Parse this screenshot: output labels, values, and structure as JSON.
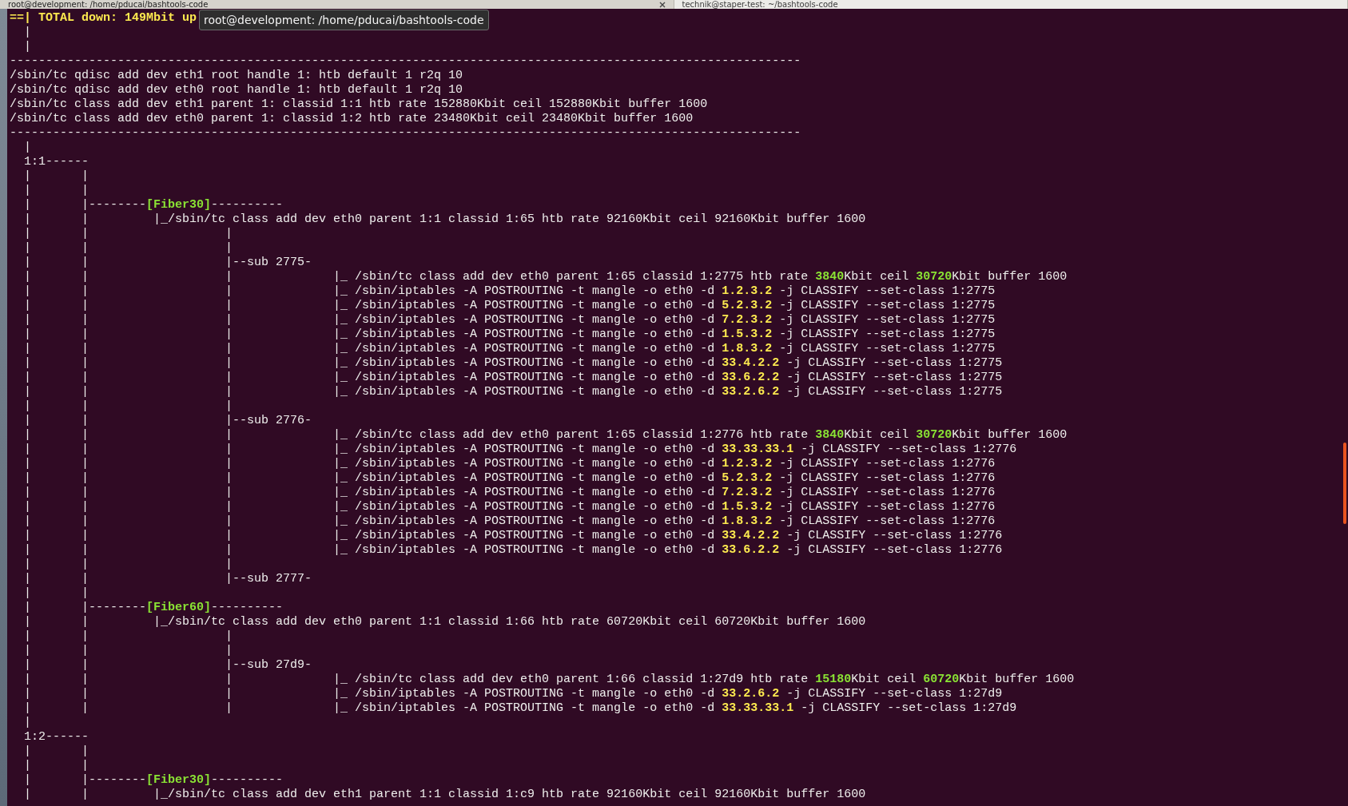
{
  "tabs": [
    {
      "label": "root@development: /home/pducai/bashtools-code",
      "selected": true
    },
    {
      "label": "technik@staper-test: ~/bashtools-code",
      "selected": false
    }
  ],
  "tooltip": "root@development: /home/pducai/bashtools-code",
  "lines": [
    [
      {
        "text": "==| TOTAL down: 149Mbit up",
        "kind": "header"
      }
    ],
    [
      {
        "text": "  |",
        "kind": "plain"
      }
    ],
    [
      {
        "text": "  |",
        "kind": "plain"
      }
    ],
    [
      {
        "text": "--------------------------------------------------------------------------------------------------------------",
        "kind": "plain"
      }
    ],
    [
      {
        "text": "/sbin/tc qdisc add dev eth1 root handle 1: htb default 1 r2q 10",
        "kind": "plain"
      }
    ],
    [
      {
        "text": "/sbin/tc qdisc add dev eth0 root handle 1: htb default 1 r2q 10",
        "kind": "plain"
      }
    ],
    [
      {
        "text": "/sbin/tc class add dev eth1 parent 1: classid 1:1 htb rate 152880Kbit ceil 152880Kbit buffer 1600",
        "kind": "plain"
      }
    ],
    [
      {
        "text": "/sbin/tc class add dev eth0 parent 1: classid 1:2 htb rate 23480Kbit ceil 23480Kbit buffer 1600",
        "kind": "plain"
      }
    ],
    [
      {
        "text": "--------------------------------------------------------------------------------------------------------------",
        "kind": "plain"
      }
    ],
    [
      {
        "text": "  |",
        "kind": "plain"
      }
    ],
    [
      {
        "text": "  1:1------",
        "kind": "plain"
      }
    ],
    [
      {
        "text": "  |       |",
        "kind": "plain"
      }
    ],
    [
      {
        "text": "  |       |",
        "kind": "plain"
      }
    ],
    [
      {
        "text": "  |       |--------",
        "kind": "plain"
      },
      {
        "text": "[Fiber30]",
        "kind": "group"
      },
      {
        "text": "----------",
        "kind": "plain"
      }
    ],
    [
      {
        "text": "  |       |         |_/sbin/tc class add dev eth0 parent 1:1 classid 1:65 htb rate 92160Kbit ceil 92160Kbit buffer 1600",
        "kind": "plain"
      }
    ],
    [
      {
        "text": "  |       |                   |",
        "kind": "plain"
      }
    ],
    [
      {
        "text": "  |       |                   |",
        "kind": "plain"
      }
    ],
    [
      {
        "text": "  |       |                   |--sub 2775-",
        "kind": "plain"
      }
    ],
    [
      {
        "text": "  |       |                   |              |_ /sbin/tc class add dev eth0 parent 1:65 classid 1:2775 htb rate ",
        "kind": "plain"
      },
      {
        "text": "3840",
        "kind": "rate"
      },
      {
        "text": "Kbit ceil ",
        "kind": "plain"
      },
      {
        "text": "30720",
        "kind": "rate"
      },
      {
        "text": "Kbit buffer 1600",
        "kind": "plain"
      }
    ],
    [
      {
        "text": "  |       |                   |              |_ /sbin/iptables -A POSTROUTING -t mangle -o eth0 -d ",
        "kind": "plain"
      },
      {
        "text": "1.2.3.2",
        "kind": "ip"
      },
      {
        "text": " -j CLASSIFY --set-class 1:2775",
        "kind": "plain"
      }
    ],
    [
      {
        "text": "  |       |                   |              |_ /sbin/iptables -A POSTROUTING -t mangle -o eth0 -d ",
        "kind": "plain"
      },
      {
        "text": "5.2.3.2",
        "kind": "ip"
      },
      {
        "text": " -j CLASSIFY --set-class 1:2775",
        "kind": "plain"
      }
    ],
    [
      {
        "text": "  |       |                   |              |_ /sbin/iptables -A POSTROUTING -t mangle -o eth0 -d ",
        "kind": "plain"
      },
      {
        "text": "7.2.3.2",
        "kind": "ip"
      },
      {
        "text": " -j CLASSIFY --set-class 1:2775",
        "kind": "plain"
      }
    ],
    [
      {
        "text": "  |       |                   |              |_ /sbin/iptables -A POSTROUTING -t mangle -o eth0 -d ",
        "kind": "plain"
      },
      {
        "text": "1.5.3.2",
        "kind": "ip"
      },
      {
        "text": " -j CLASSIFY --set-class 1:2775",
        "kind": "plain"
      }
    ],
    [
      {
        "text": "  |       |                   |              |_ /sbin/iptables -A POSTROUTING -t mangle -o eth0 -d ",
        "kind": "plain"
      },
      {
        "text": "1.8.3.2",
        "kind": "ip"
      },
      {
        "text": " -j CLASSIFY --set-class 1:2775",
        "kind": "plain"
      }
    ],
    [
      {
        "text": "  |       |                   |              |_ /sbin/iptables -A POSTROUTING -t mangle -o eth0 -d ",
        "kind": "plain"
      },
      {
        "text": "33.4.2.2",
        "kind": "ip"
      },
      {
        "text": " -j CLASSIFY --set-class 1:2775",
        "kind": "plain"
      }
    ],
    [
      {
        "text": "  |       |                   |              |_ /sbin/iptables -A POSTROUTING -t mangle -o eth0 -d ",
        "kind": "plain"
      },
      {
        "text": "33.6.2.2",
        "kind": "ip"
      },
      {
        "text": " -j CLASSIFY --set-class 1:2775",
        "kind": "plain"
      }
    ],
    [
      {
        "text": "  |       |                   |              |_ /sbin/iptables -A POSTROUTING -t mangle -o eth0 -d ",
        "kind": "plain"
      },
      {
        "text": "33.2.6.2",
        "kind": "ip"
      },
      {
        "text": " -j CLASSIFY --set-class 1:2775",
        "kind": "plain"
      }
    ],
    [
      {
        "text": "  |       |                   |",
        "kind": "plain"
      }
    ],
    [
      {
        "text": "  |       |                   |--sub 2776-",
        "kind": "plain"
      }
    ],
    [
      {
        "text": "  |       |                   |              |_ /sbin/tc class add dev eth0 parent 1:65 classid 1:2776 htb rate ",
        "kind": "plain"
      },
      {
        "text": "3840",
        "kind": "rate"
      },
      {
        "text": "Kbit ceil ",
        "kind": "plain"
      },
      {
        "text": "30720",
        "kind": "rate"
      },
      {
        "text": "Kbit buffer 1600",
        "kind": "plain"
      }
    ],
    [
      {
        "text": "  |       |                   |              |_ /sbin/iptables -A POSTROUTING -t mangle -o eth0 -d ",
        "kind": "plain"
      },
      {
        "text": "33.33.33.1",
        "kind": "ip"
      },
      {
        "text": " -j CLASSIFY --set-class 1:2776",
        "kind": "plain"
      }
    ],
    [
      {
        "text": "  |       |                   |              |_ /sbin/iptables -A POSTROUTING -t mangle -o eth0 -d ",
        "kind": "plain"
      },
      {
        "text": "1.2.3.2",
        "kind": "ip"
      },
      {
        "text": " -j CLASSIFY --set-class 1:2776",
        "kind": "plain"
      }
    ],
    [
      {
        "text": "  |       |                   |              |_ /sbin/iptables -A POSTROUTING -t mangle -o eth0 -d ",
        "kind": "plain"
      },
      {
        "text": "5.2.3.2",
        "kind": "ip"
      },
      {
        "text": " -j CLASSIFY --set-class 1:2776",
        "kind": "plain"
      }
    ],
    [
      {
        "text": "  |       |                   |              |_ /sbin/iptables -A POSTROUTING -t mangle -o eth0 -d ",
        "kind": "plain"
      },
      {
        "text": "7.2.3.2",
        "kind": "ip"
      },
      {
        "text": " -j CLASSIFY --set-class 1:2776",
        "kind": "plain"
      }
    ],
    [
      {
        "text": "  |       |                   |              |_ /sbin/iptables -A POSTROUTING -t mangle -o eth0 -d ",
        "kind": "plain"
      },
      {
        "text": "1.5.3.2",
        "kind": "ip"
      },
      {
        "text": " -j CLASSIFY --set-class 1:2776",
        "kind": "plain"
      }
    ],
    [
      {
        "text": "  |       |                   |              |_ /sbin/iptables -A POSTROUTING -t mangle -o eth0 -d ",
        "kind": "plain"
      },
      {
        "text": "1.8.3.2",
        "kind": "ip"
      },
      {
        "text": " -j CLASSIFY --set-class 1:2776",
        "kind": "plain"
      }
    ],
    [
      {
        "text": "  |       |                   |              |_ /sbin/iptables -A POSTROUTING -t mangle -o eth0 -d ",
        "kind": "plain"
      },
      {
        "text": "33.4.2.2",
        "kind": "ip"
      },
      {
        "text": " -j CLASSIFY --set-class 1:2776",
        "kind": "plain"
      }
    ],
    [
      {
        "text": "  |       |                   |              |_ /sbin/iptables -A POSTROUTING -t mangle -o eth0 -d ",
        "kind": "plain"
      },
      {
        "text": "33.6.2.2",
        "kind": "ip"
      },
      {
        "text": " -j CLASSIFY --set-class 1:2776",
        "kind": "plain"
      }
    ],
    [
      {
        "text": "  |       |                   |",
        "kind": "plain"
      }
    ],
    [
      {
        "text": "  |       |                   |--sub 2777-",
        "kind": "plain"
      }
    ],
    [
      {
        "text": "  |       |",
        "kind": "plain"
      }
    ],
    [
      {
        "text": "  |       |--------",
        "kind": "plain"
      },
      {
        "text": "[Fiber60]",
        "kind": "group"
      },
      {
        "text": "----------",
        "kind": "plain"
      }
    ],
    [
      {
        "text": "  |       |         |_/sbin/tc class add dev eth0 parent 1:1 classid 1:66 htb rate 60720Kbit ceil 60720Kbit buffer 1600",
        "kind": "plain"
      }
    ],
    [
      {
        "text": "  |       |                   |",
        "kind": "plain"
      }
    ],
    [
      {
        "text": "  |       |                   |",
        "kind": "plain"
      }
    ],
    [
      {
        "text": "  |       |                   |--sub 27d9-",
        "kind": "plain"
      }
    ],
    [
      {
        "text": "  |       |                   |              |_ /sbin/tc class add dev eth0 parent 1:66 classid 1:27d9 htb rate ",
        "kind": "plain"
      },
      {
        "text": "15180",
        "kind": "rate"
      },
      {
        "text": "Kbit ceil ",
        "kind": "plain"
      },
      {
        "text": "60720",
        "kind": "rate"
      },
      {
        "text": "Kbit buffer 1600",
        "kind": "plain"
      }
    ],
    [
      {
        "text": "  |       |                   |              |_ /sbin/iptables -A POSTROUTING -t mangle -o eth0 -d ",
        "kind": "plain"
      },
      {
        "text": "33.2.6.2",
        "kind": "ip"
      },
      {
        "text": " -j CLASSIFY --set-class 1:27d9",
        "kind": "plain"
      }
    ],
    [
      {
        "text": "  |       |                   |              |_ /sbin/iptables -A POSTROUTING -t mangle -o eth0 -d ",
        "kind": "plain"
      },
      {
        "text": "33.33.33.1",
        "kind": "ip"
      },
      {
        "text": " -j CLASSIFY --set-class 1:27d9",
        "kind": "plain"
      }
    ],
    [
      {
        "text": "  |",
        "kind": "plain"
      }
    ],
    [
      {
        "text": "  1:2------",
        "kind": "plain"
      }
    ],
    [
      {
        "text": "  |       |",
        "kind": "plain"
      }
    ],
    [
      {
        "text": "  |       |",
        "kind": "plain"
      }
    ],
    [
      {
        "text": "  |       |--------",
        "kind": "plain"
      },
      {
        "text": "[Fiber30]",
        "kind": "group"
      },
      {
        "text": "----------",
        "kind": "plain"
      }
    ],
    [
      {
        "text": "  |       |         |_/sbin/tc class add dev eth1 parent 1:1 classid 1:c9 htb rate 92160Kbit ceil 92160Kbit buffer 1600",
        "kind": "plain"
      }
    ]
  ]
}
